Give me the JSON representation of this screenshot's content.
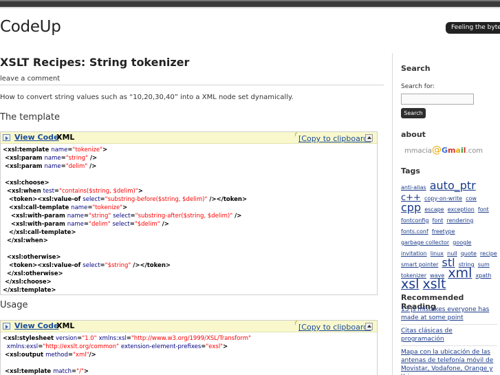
{
  "site": {
    "title": "CodeUp",
    "tagline": "Feeling the byte"
  },
  "post": {
    "title": "XSLT Recipes: String tokenizer",
    "leave_comment": "leave a comment",
    "intro": "How to convert string values such as “10,20,30,40” into a XML node set dynamically.",
    "sections": {
      "template": "The template",
      "usage": "Usage"
    }
  },
  "codebox": {
    "view_code": "View Code",
    "lang": "XML",
    "help": "?",
    "copy": "[Copy to clipboard]"
  },
  "code_template": [
    [
      [
        "t",
        "<xsl:template "
      ],
      [
        "a",
        "name"
      ],
      [
        "t",
        "="
      ],
      [
        "v",
        "\"tokenize\""
      ],
      [
        "t",
        ">"
      ]
    ],
    [
      [
        "t",
        " <xsl:param "
      ],
      [
        "a",
        "name"
      ],
      [
        "t",
        "="
      ],
      [
        "v",
        "\"string\""
      ],
      [
        "t",
        " />"
      ]
    ],
    [
      [
        "t",
        " <xsl:param "
      ],
      [
        "a",
        "name"
      ],
      [
        "t",
        "="
      ],
      [
        "v",
        "\"delim\""
      ],
      [
        "t",
        " />"
      ]
    ],
    [],
    [
      [
        "t",
        " <xsl:choose>"
      ]
    ],
    [
      [
        "t",
        "  <xsl:when "
      ],
      [
        "a",
        "test"
      ],
      [
        "t",
        "="
      ],
      [
        "v",
        "\"contains($string, $delim)\""
      ],
      [
        "t",
        ">"
      ]
    ],
    [
      [
        "t",
        "   <token><xsl:value-of "
      ],
      [
        "a",
        "select"
      ],
      [
        "t",
        "="
      ],
      [
        "v",
        "\"substring-before($string, $delim)\""
      ],
      [
        "t",
        " /></token>"
      ]
    ],
    [
      [
        "t",
        "   <xsl:call-template "
      ],
      [
        "a",
        "name"
      ],
      [
        "t",
        "="
      ],
      [
        "v",
        "\"tokenize\""
      ],
      [
        "t",
        ">"
      ]
    ],
    [
      [
        "t",
        "    <xsl:with-param "
      ],
      [
        "a",
        "name"
      ],
      [
        "t",
        "="
      ],
      [
        "v",
        "\"string\""
      ],
      [
        "t",
        " "
      ],
      [
        "a",
        "select"
      ],
      [
        "t",
        "="
      ],
      [
        "v",
        "\"substring-after($string, $delim)\""
      ],
      [
        "t",
        " />"
      ]
    ],
    [
      [
        "t",
        "    <xsl:with-param "
      ],
      [
        "a",
        "name"
      ],
      [
        "t",
        "="
      ],
      [
        "v",
        "\"delim\""
      ],
      [
        "t",
        " "
      ],
      [
        "a",
        "select"
      ],
      [
        "t",
        "="
      ],
      [
        "v",
        "\"$delim\""
      ],
      [
        "t",
        " />"
      ]
    ],
    [
      [
        "t",
        "   </xsl:call-template>"
      ]
    ],
    [
      [
        "t",
        "  </xsl:when>"
      ]
    ],
    [],
    [
      [
        "t",
        "  <xsl:otherwise>"
      ]
    ],
    [
      [
        "t",
        "   <token><xsl:value-of "
      ],
      [
        "a",
        "select"
      ],
      [
        "t",
        "="
      ],
      [
        "v",
        "\"$string\""
      ],
      [
        "t",
        " /></token>"
      ]
    ],
    [
      [
        "t",
        "  </xsl:otherwise>"
      ]
    ],
    [
      [
        "t",
        " </xsl:choose>"
      ]
    ],
    [
      [
        "t",
        "</xsl:template>"
      ]
    ]
  ],
  "code_usage": [
    [
      [
        "t",
        "<xsl:stylesheet "
      ],
      [
        "a",
        "version"
      ],
      [
        "t",
        "="
      ],
      [
        "v",
        "\"1.0\""
      ],
      [
        "t",
        " "
      ],
      [
        "a",
        "xmlns:xsl"
      ],
      [
        "t",
        "="
      ],
      [
        "v",
        "\"http://www.w3.org/1999/XSL/Transform\""
      ]
    ],
    [
      [
        "t",
        "  "
      ],
      [
        "a",
        "xmlns:exsl"
      ],
      [
        "t",
        "="
      ],
      [
        "v",
        "\"http://exslt.org/common\""
      ],
      [
        "t",
        " "
      ],
      [
        "a",
        "extension-element-prefixes"
      ],
      [
        "t",
        "="
      ],
      [
        "v",
        "\"exsl\""
      ],
      [
        "t",
        ">"
      ]
    ],
    [
      [
        "t",
        " <xsl:output "
      ],
      [
        "a",
        "method"
      ],
      [
        "t",
        "="
      ],
      [
        "v",
        "\"xml\""
      ],
      [
        "t",
        "/>"
      ]
    ],
    [],
    [
      [
        "t",
        " <xsl:template "
      ],
      [
        "a",
        "match"
      ],
      [
        "t",
        "="
      ],
      [
        "v",
        "\"/\""
      ],
      [
        "t",
        ">"
      ]
    ]
  ],
  "sidebar": {
    "search": {
      "heading": "Search",
      "label": "Search for:",
      "input_value": "",
      "button": "Search"
    },
    "about": {
      "heading": "about",
      "email_user": "mmacia",
      "email_at": "@",
      "email_brand": [
        "G",
        "m",
        "a",
        "i",
        "l"
      ],
      "email_domain": ".com"
    },
    "tags": {
      "heading": "Tags",
      "items": [
        {
          "label": "anti-alias",
          "size": 1
        },
        {
          "label": "auto_ptr",
          "size": 3
        },
        {
          "label": "c++",
          "size": 2
        },
        {
          "label": "copy-on-write",
          "size": 1
        },
        {
          "label": "cow",
          "size": 1
        },
        {
          "label": "cpp",
          "size": 3
        },
        {
          "label": "escape",
          "size": 1
        },
        {
          "label": "exception",
          "size": 1
        },
        {
          "label": "font",
          "size": 1
        },
        {
          "label": "fontconfig",
          "size": 1
        },
        {
          "label": "font",
          "size": 1
        },
        {
          "label": "rendering",
          "size": 1
        },
        {
          "label": "fonts.conf",
          "size": 1
        },
        {
          "label": "freetype",
          "size": 1
        },
        {
          "label": "garbage collector",
          "size": 1
        },
        {
          "label": "google",
          "size": 1
        },
        {
          "label": "invitation",
          "size": 1
        },
        {
          "label": "linux",
          "size": 1
        },
        {
          "label": "null",
          "size": 1
        },
        {
          "label": "quote",
          "size": 1
        },
        {
          "label": "recipe",
          "size": 1
        },
        {
          "label": "smart pointer",
          "size": 1
        },
        {
          "label": "stl",
          "size": 3
        },
        {
          "label": "string",
          "size": 1
        },
        {
          "label": "sum",
          "size": 1
        },
        {
          "label": "tokenizer",
          "size": 1
        },
        {
          "label": "wave",
          "size": 1
        },
        {
          "label": "xml",
          "size": 4
        },
        {
          "label": "xpath",
          "size": 1
        },
        {
          "label": "xsl",
          "size": 4
        },
        {
          "label": "xslt",
          "size": 4
        }
      ]
    },
    "reading": {
      "heading": "Recommended Reading",
      "items": [
        "13 js mistakes everyone has made at some point",
        "Citas clásicas de programación",
        "Mapa con la ubicación de las antenas de telefonía móvil de Movistar, Vodafone, Orange y Yoigo"
      ]
    }
  }
}
